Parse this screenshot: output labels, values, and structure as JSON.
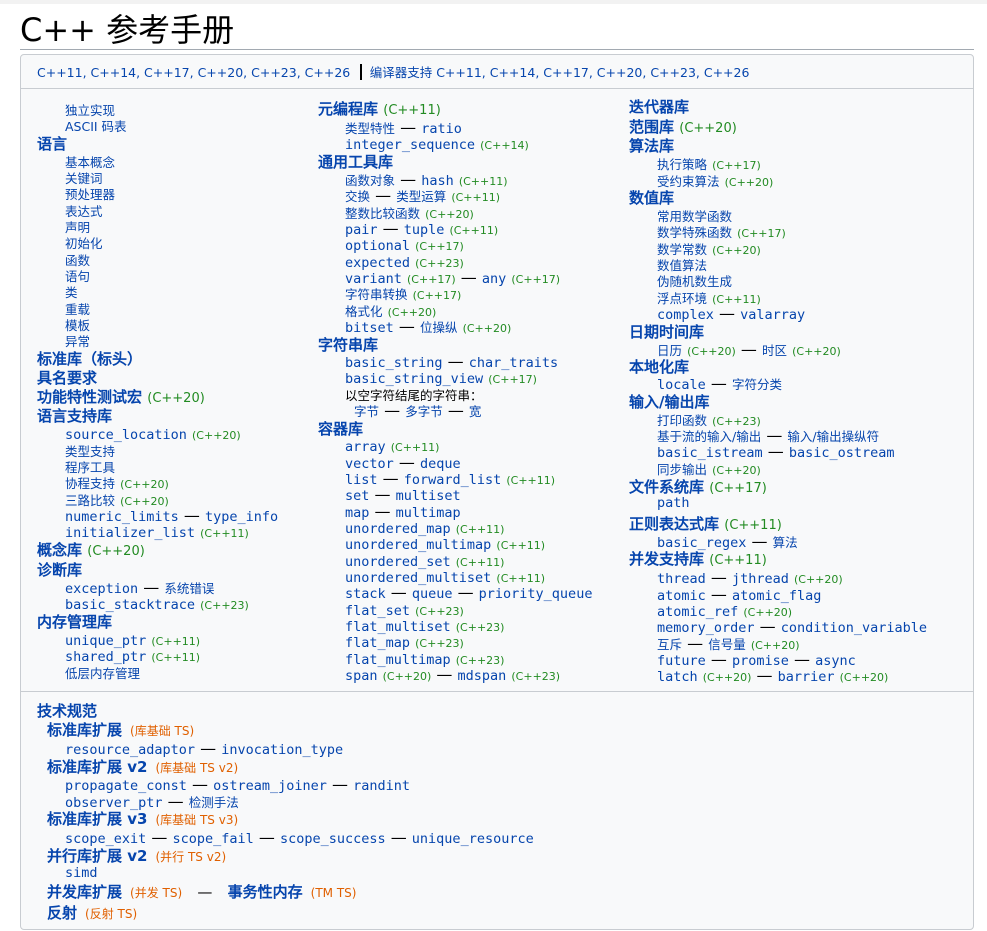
{
  "page": {
    "title": "C++ 参考手册"
  },
  "version_bar": {
    "versions": "C++11, C++14, C++17, C++20, C++23, C++26",
    "compiler": "编译器支持 C++11, C++14, C++17, C++20, C++23, C++26"
  },
  "col1": {
    "freestanding": "独立实现",
    "ascii": "ASCII 码表",
    "language": "语言",
    "lang_items": [
      "基本概念",
      "关键词",
      "预处理器",
      "表达式",
      "声明",
      "初始化",
      "函数",
      "语句",
      "类",
      "重载",
      "模板",
      "异常"
    ],
    "stdlib": "标准库（标头）",
    "named_req": "具名要求",
    "feature_macros": "功能特性测试宏",
    "feature_macros_ver": "(C++20)",
    "lang_support": "语言支持库",
    "source_location": "source_location",
    "source_location_ver": "(C++20)",
    "type_support": "类型支持",
    "program_utils": "程序工具",
    "coroutine": "协程支持",
    "coroutine_ver": "(C++20)",
    "three_way": "三路比较",
    "three_way_ver": "(C++20)",
    "numeric_limits": "numeric_limits",
    "type_info": "type_info",
    "initializer_list": "initializer_list",
    "initializer_list_ver": "(C++11)",
    "concepts": "概念库",
    "concepts_ver": "(C++20)",
    "diagnostics": "诊断库",
    "exception": "exception",
    "system_error": "系统错误",
    "basic_stacktrace": "basic_stacktrace",
    "basic_stacktrace_ver": "(C++23)",
    "memory": "内存管理库",
    "unique_ptr": "unique_ptr",
    "unique_ptr_ver": "(C++11)",
    "shared_ptr": "shared_ptr",
    "shared_ptr_ver": "(C++11)",
    "low_memory": "低层内存管理"
  },
  "col2": {
    "metaprogramming": "元编程库",
    "metaprogramming_ver": "(C++11)",
    "type_traits": "类型特性",
    "ratio": "ratio",
    "integer_sequence": "integer_sequence",
    "integer_sequence_ver": "(C++14)",
    "utilities": "通用工具库",
    "function_objects": "函数对象",
    "hash": "hash",
    "hash_ver": "(C++11)",
    "swap": "交换",
    "type_ops": "类型运算",
    "type_ops_ver": "(C++11)",
    "int_cmp": "整数比较函数",
    "int_cmp_ver": "(C++20)",
    "pair": "pair",
    "tuple": "tuple",
    "tuple_ver": "(C++11)",
    "optional": "optional",
    "optional_ver": "(C++17)",
    "expected": "expected",
    "expected_ver": "(C++23)",
    "variant": "variant",
    "variant_ver": "(C++17)",
    "any": "any",
    "any_ver": "(C++17)",
    "string_conv": "字符串转换",
    "string_conv_ver": "(C++17)",
    "formatting": "格式化",
    "formatting_ver": "(C++20)",
    "bitset": "bitset",
    "bit_manip": "位操纵",
    "bit_manip_ver": "(C++20)",
    "strings": "字符串库",
    "basic_string": "basic_string",
    "char_traits": "char_traits",
    "basic_string_view": "basic_string_view",
    "basic_string_view_ver": "(C++17)",
    "null_terminated": "以空字符结尾的字符串：",
    "byte_str": "字节",
    "multibyte": "多字节",
    "wide": "宽",
    "containers": "容器库",
    "array": "array",
    "array_ver": "(C++11)",
    "vector": "vector",
    "deque": "deque",
    "list": "list",
    "forward_list": "forward_list",
    "forward_list_ver": "(C++11)",
    "set": "set",
    "multiset": "multiset",
    "map": "map",
    "multimap": "multimap",
    "unordered_map": "unordered_map",
    "unordered_map_ver": "(C++11)",
    "unordered_multimap": "unordered_multimap",
    "unordered_multimap_ver": "(C++11)",
    "unordered_set": "unordered_set",
    "unordered_set_ver": "(C++11)",
    "unordered_multiset": "unordered_multiset",
    "unordered_multiset_ver": "(C++11)",
    "stack": "stack",
    "queue": "queue",
    "priority_queue": "priority_queue",
    "flat_set": "flat_set",
    "flat_set_ver": "(C++23)",
    "flat_multiset": "flat_multiset",
    "flat_multiset_ver": "(C++23)",
    "flat_map": "flat_map",
    "flat_map_ver": "(C++23)",
    "flat_multimap": "flat_multimap",
    "flat_multimap_ver": "(C++23)",
    "span": "span",
    "span_ver": "(C++20)",
    "mdspan": "mdspan",
    "mdspan_ver": "(C++23)"
  },
  "col3": {
    "iterators": "迭代器库",
    "ranges": "范围库",
    "ranges_ver": "(C++20)",
    "algorithms": "算法库",
    "exec_policy": "执行策略",
    "exec_policy_ver": "(C++17)",
    "constrained_alg": "受约束算法",
    "constrained_alg_ver": "(C++20)",
    "numerics": "数值库",
    "common_math": "常用数学函数",
    "special_math": "数学特殊函数",
    "special_math_ver": "(C++17)",
    "math_constants": "数学常数",
    "math_constants_ver": "(C++20)",
    "numeric_alg": "数值算法",
    "prng": "伪随机数生成",
    "fenv": "浮点环境",
    "fenv_ver": "(C++11)",
    "complex": "complex",
    "valarray": "valarray",
    "datetime": "日期时间库",
    "calendar": "日历",
    "calendar_ver": "(C++20)",
    "timezone": "时区",
    "timezone_ver": "(C++20)",
    "localization": "本地化库",
    "locale": "locale",
    "char_class": "字符分类",
    "io": "输入/输出库",
    "print": "打印函数",
    "print_ver": "(C++23)",
    "stream_io": "基于流的输入/输出",
    "io_manip": "输入/输出操纵符",
    "basic_istream": "basic_istream",
    "basic_ostream": "basic_ostream",
    "sync_out": "同步输出",
    "sync_out_ver": "(C++20)",
    "filesystem": "文件系统库",
    "filesystem_ver": "(C++17)",
    "path": "path",
    "regex": "正则表达式库",
    "regex_ver": "(C++11)",
    "basic_regex": "basic_regex",
    "regex_alg": "算法",
    "concurrency": "并发支持库",
    "concurrency_ver": "(C++11)",
    "thread": "thread",
    "jthread": "jthread",
    "jthread_ver": "(C++20)",
    "atomic": "atomic",
    "atomic_flag": "atomic_flag",
    "atomic_ref": "atomic_ref",
    "atomic_ref_ver": "(C++20)",
    "memory_order": "memory_order",
    "condition_variable": "condition_variable",
    "mutex": "互斥",
    "semaphore": "信号量",
    "semaphore_ver": "(C++20)",
    "future": "future",
    "promise": "promise",
    "async": "async",
    "latch": "latch",
    "latch_ver": "(C++20)",
    "barrier": "barrier",
    "barrier_ver": "(C++20)"
  },
  "tech_specs": {
    "title": "技术规范",
    "ext1": "标准库扩展",
    "ext1_ts": "(库基础 TS)",
    "resource_adaptor": "resource_adaptor",
    "invocation_type": "invocation_type",
    "ext2": "标准库扩展 v2",
    "ext2_ts": "(库基础 TS v2)",
    "propagate_const": "propagate_const",
    "ostream_joiner": "ostream_joiner",
    "randint": "randint",
    "observer_ptr": "observer_ptr",
    "detection": "检测手法",
    "ext3": "标准库扩展 v3",
    "ext3_ts": "(库基础 TS v3)",
    "scope_exit": "scope_exit",
    "scope_fail": "scope_fail",
    "scope_success": "scope_success",
    "unique_resource": "unique_resource",
    "parallel": "并行库扩展 v2",
    "parallel_ts": "(并行 TS v2)",
    "simd": "simd",
    "concurrency_ext": "并发库扩展",
    "concurrency_ext_ts": "(并发 TS)",
    "transactional": "事务性内存",
    "transactional_ts": "(TM TS)",
    "reflection": "反射",
    "reflection_ts": "(反射 TS)"
  },
  "colors": {
    "link": "#0645ad",
    "version": "#228b22",
    "ts": "#e06000",
    "panel": "#f8f9fa",
    "border": "#c8ccd1"
  }
}
